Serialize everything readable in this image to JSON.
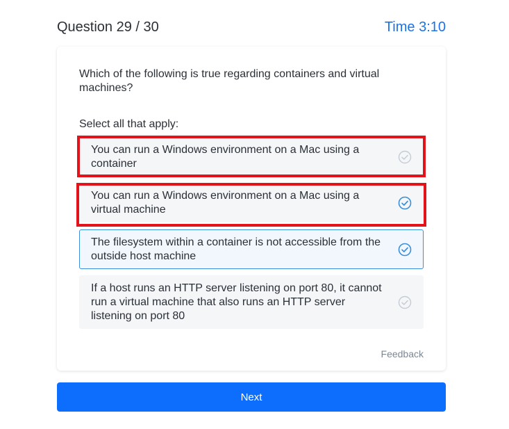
{
  "header": {
    "question_counter": "Question 29 / 30",
    "timer": "Time 3:10"
  },
  "question": {
    "text": "Which of the following is true regarding containers and virtual machines?",
    "instruction": "Select all that apply:"
  },
  "options": [
    {
      "label": "You can run a Windows environment on a Mac using a container",
      "selected": false,
      "highlighted": true
    },
    {
      "label": "You can run a Windows environment on a Mac using a virtual machine",
      "selected": true,
      "highlighted": true
    },
    {
      "label": "The filesystem within a container is not accessible from the outside host machine",
      "selected": true,
      "highlighted": false
    },
    {
      "label": "If a host runs an HTTP server listening on port 80, it cannot run a virtual machine that also runs an HTTP server listening on port 80",
      "selected": false,
      "highlighted": false
    }
  ],
  "feedback_label": "Feedback",
  "next_label": "Next",
  "colors": {
    "accent": "#1a73e8",
    "button": "#0d6efd",
    "highlight": "#e3131c",
    "check_selected": "#3b8fd9",
    "check_unselected": "#c5ccd4"
  }
}
